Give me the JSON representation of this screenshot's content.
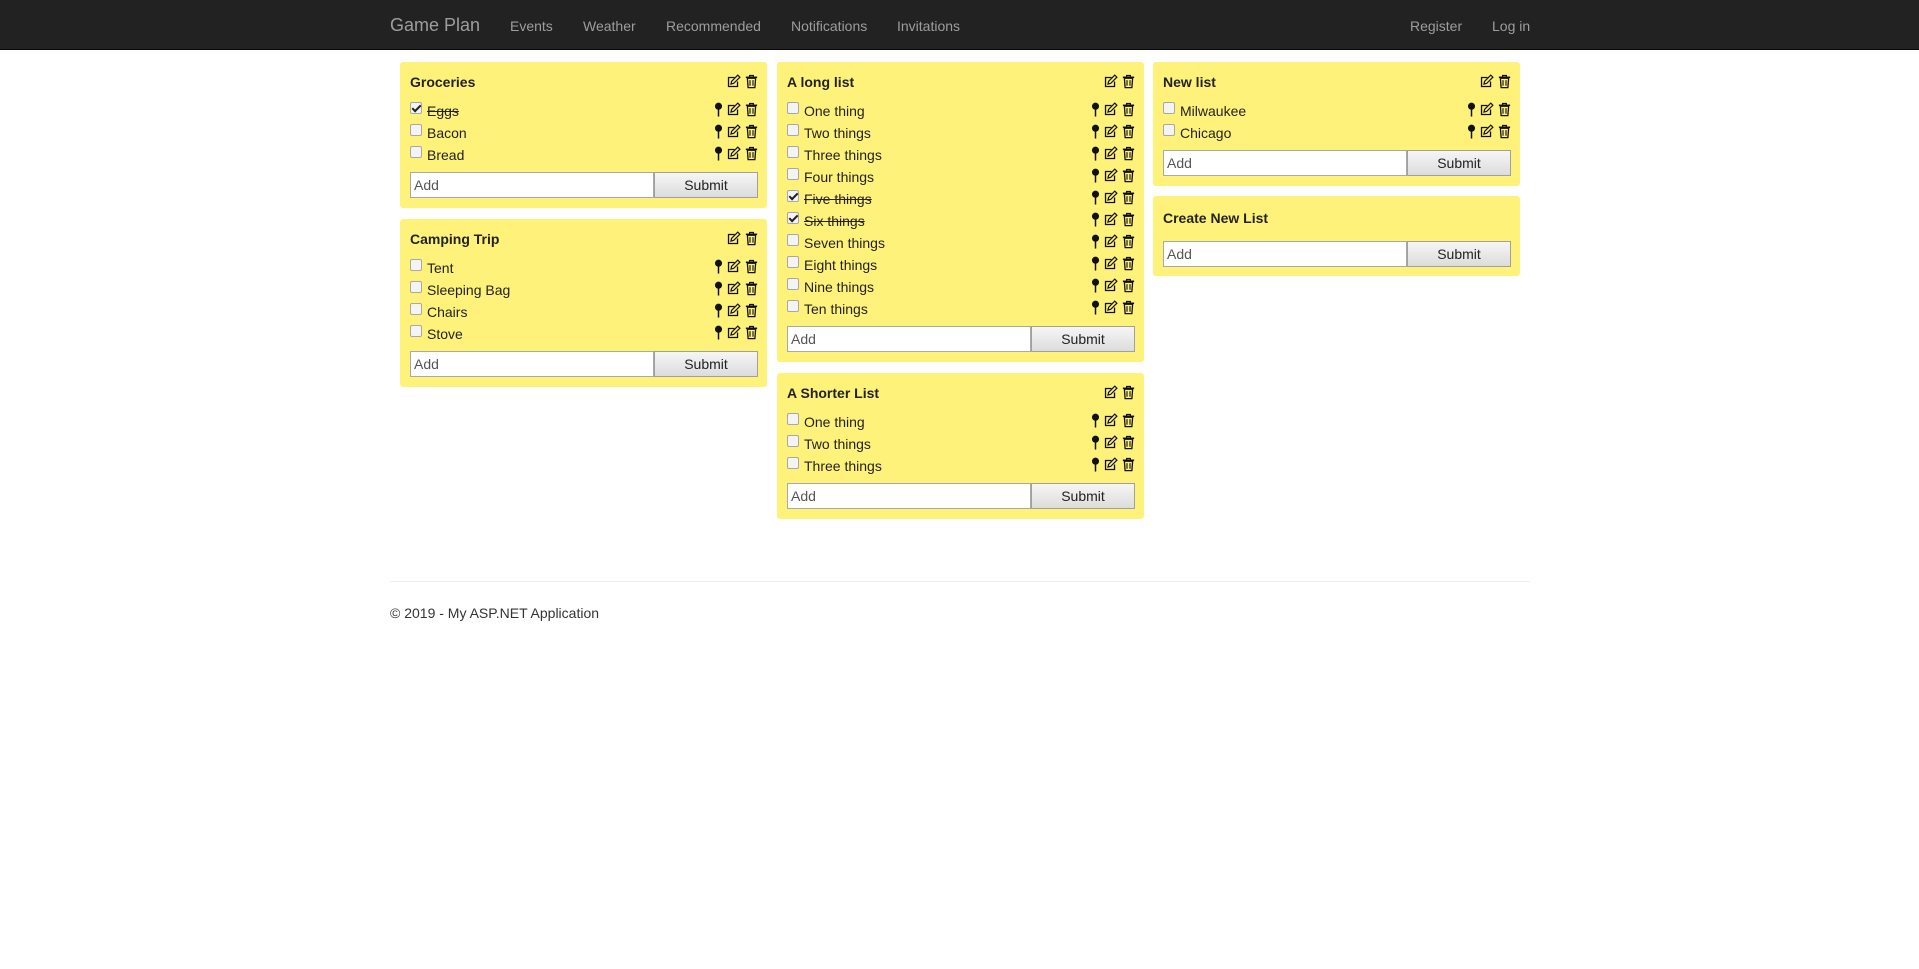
{
  "navbar": {
    "brand": "Game Plan",
    "links": [
      "Events",
      "Weather",
      "Recommended",
      "Notifications",
      "Invitations"
    ],
    "right_links": [
      "Register",
      "Log in"
    ]
  },
  "lists": [
    {
      "title": "Groceries",
      "items": [
        {
          "text": "Eggs",
          "checked": true
        },
        {
          "text": "Bacon",
          "checked": false
        },
        {
          "text": "Bread",
          "checked": false
        }
      ]
    },
    {
      "title": "Camping Trip",
      "items": [
        {
          "text": "Tent",
          "checked": false
        },
        {
          "text": "Sleeping Bag",
          "checked": false
        },
        {
          "text": "Chairs",
          "checked": false
        },
        {
          "text": "Stove",
          "checked": false
        }
      ]
    },
    {
      "title": "A long list",
      "items": [
        {
          "text": "One thing",
          "checked": false
        },
        {
          "text": "Two things",
          "checked": false
        },
        {
          "text": "Three things",
          "checked": false
        },
        {
          "text": "Four things",
          "checked": false
        },
        {
          "text": "Five things",
          "checked": true
        },
        {
          "text": "Six things",
          "checked": true
        },
        {
          "text": "Seven things",
          "checked": false
        },
        {
          "text": "Eight things",
          "checked": false
        },
        {
          "text": "Nine things",
          "checked": false
        },
        {
          "text": "Ten things",
          "checked": false
        }
      ]
    },
    {
      "title": "A Shorter List",
      "items": [
        {
          "text": "One thing",
          "checked": false
        },
        {
          "text": "Two things",
          "checked": false
        },
        {
          "text": "Three things",
          "checked": false
        }
      ]
    },
    {
      "title": "New list",
      "items": [
        {
          "text": "Milwaukee",
          "checked": false
        },
        {
          "text": "Chicago",
          "checked": false
        }
      ]
    }
  ],
  "create_list": {
    "title": "Create New List"
  },
  "add_placeholder": "Add",
  "submit_label": "Submit",
  "footer": {
    "text": "© 2019 - My ASP.NET Application"
  },
  "colors": {
    "card": "#fff27a",
    "navbar": "#222222",
    "nav_text": "#9d9d9d"
  },
  "icons": {
    "pin": "pin-icon",
    "edit": "edit-icon",
    "delete": "trash-icon"
  }
}
